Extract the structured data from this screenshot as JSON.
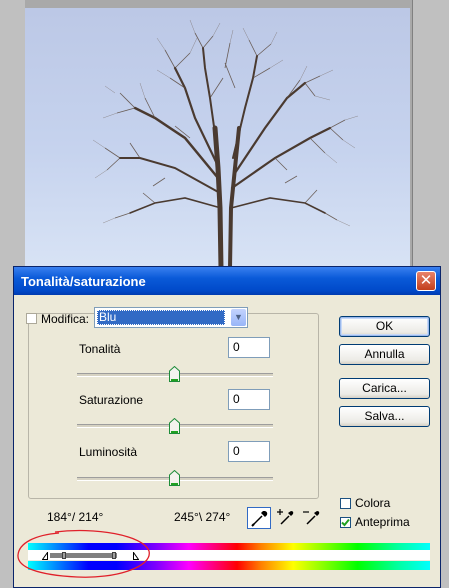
{
  "dialog": {
    "title": "Tonalità/saturazione",
    "close_glyph": "✕"
  },
  "modifica": {
    "label": "Modifica:",
    "selected": "Blu"
  },
  "sliders": [
    {
      "label": "Tonalità",
      "value": "0",
      "position_fraction": 0.5
    },
    {
      "label": "Saturazione",
      "value": "0",
      "position_fraction": 0.5
    },
    {
      "label": "Luminosità",
      "value": "0",
      "position_fraction": 0.5
    }
  ],
  "buttons": {
    "ok": "OK",
    "cancel": "Annulla",
    "load": "Carica...",
    "save": "Salva..."
  },
  "checkboxes": {
    "colorize": {
      "label": "Colora",
      "checked": false
    },
    "preview": {
      "label": "Anteprima",
      "checked": true
    }
  },
  "ranges": {
    "left": "184°/ 214°",
    "right": "245°\\ 274°"
  },
  "icons": {
    "eyedropper": "eyedropper-icon",
    "eyedropper_plus": "eyedropper-plus-icon",
    "eyedropper_minus": "eyedropper-minus-icon",
    "close": "close-icon",
    "dropdown": "chevron-down-icon"
  },
  "colors": {
    "title_bar": "#0a5ad8",
    "dialog_bg": "#ece9d8",
    "selection": "#316ac5",
    "annotation": "#e0202a"
  }
}
